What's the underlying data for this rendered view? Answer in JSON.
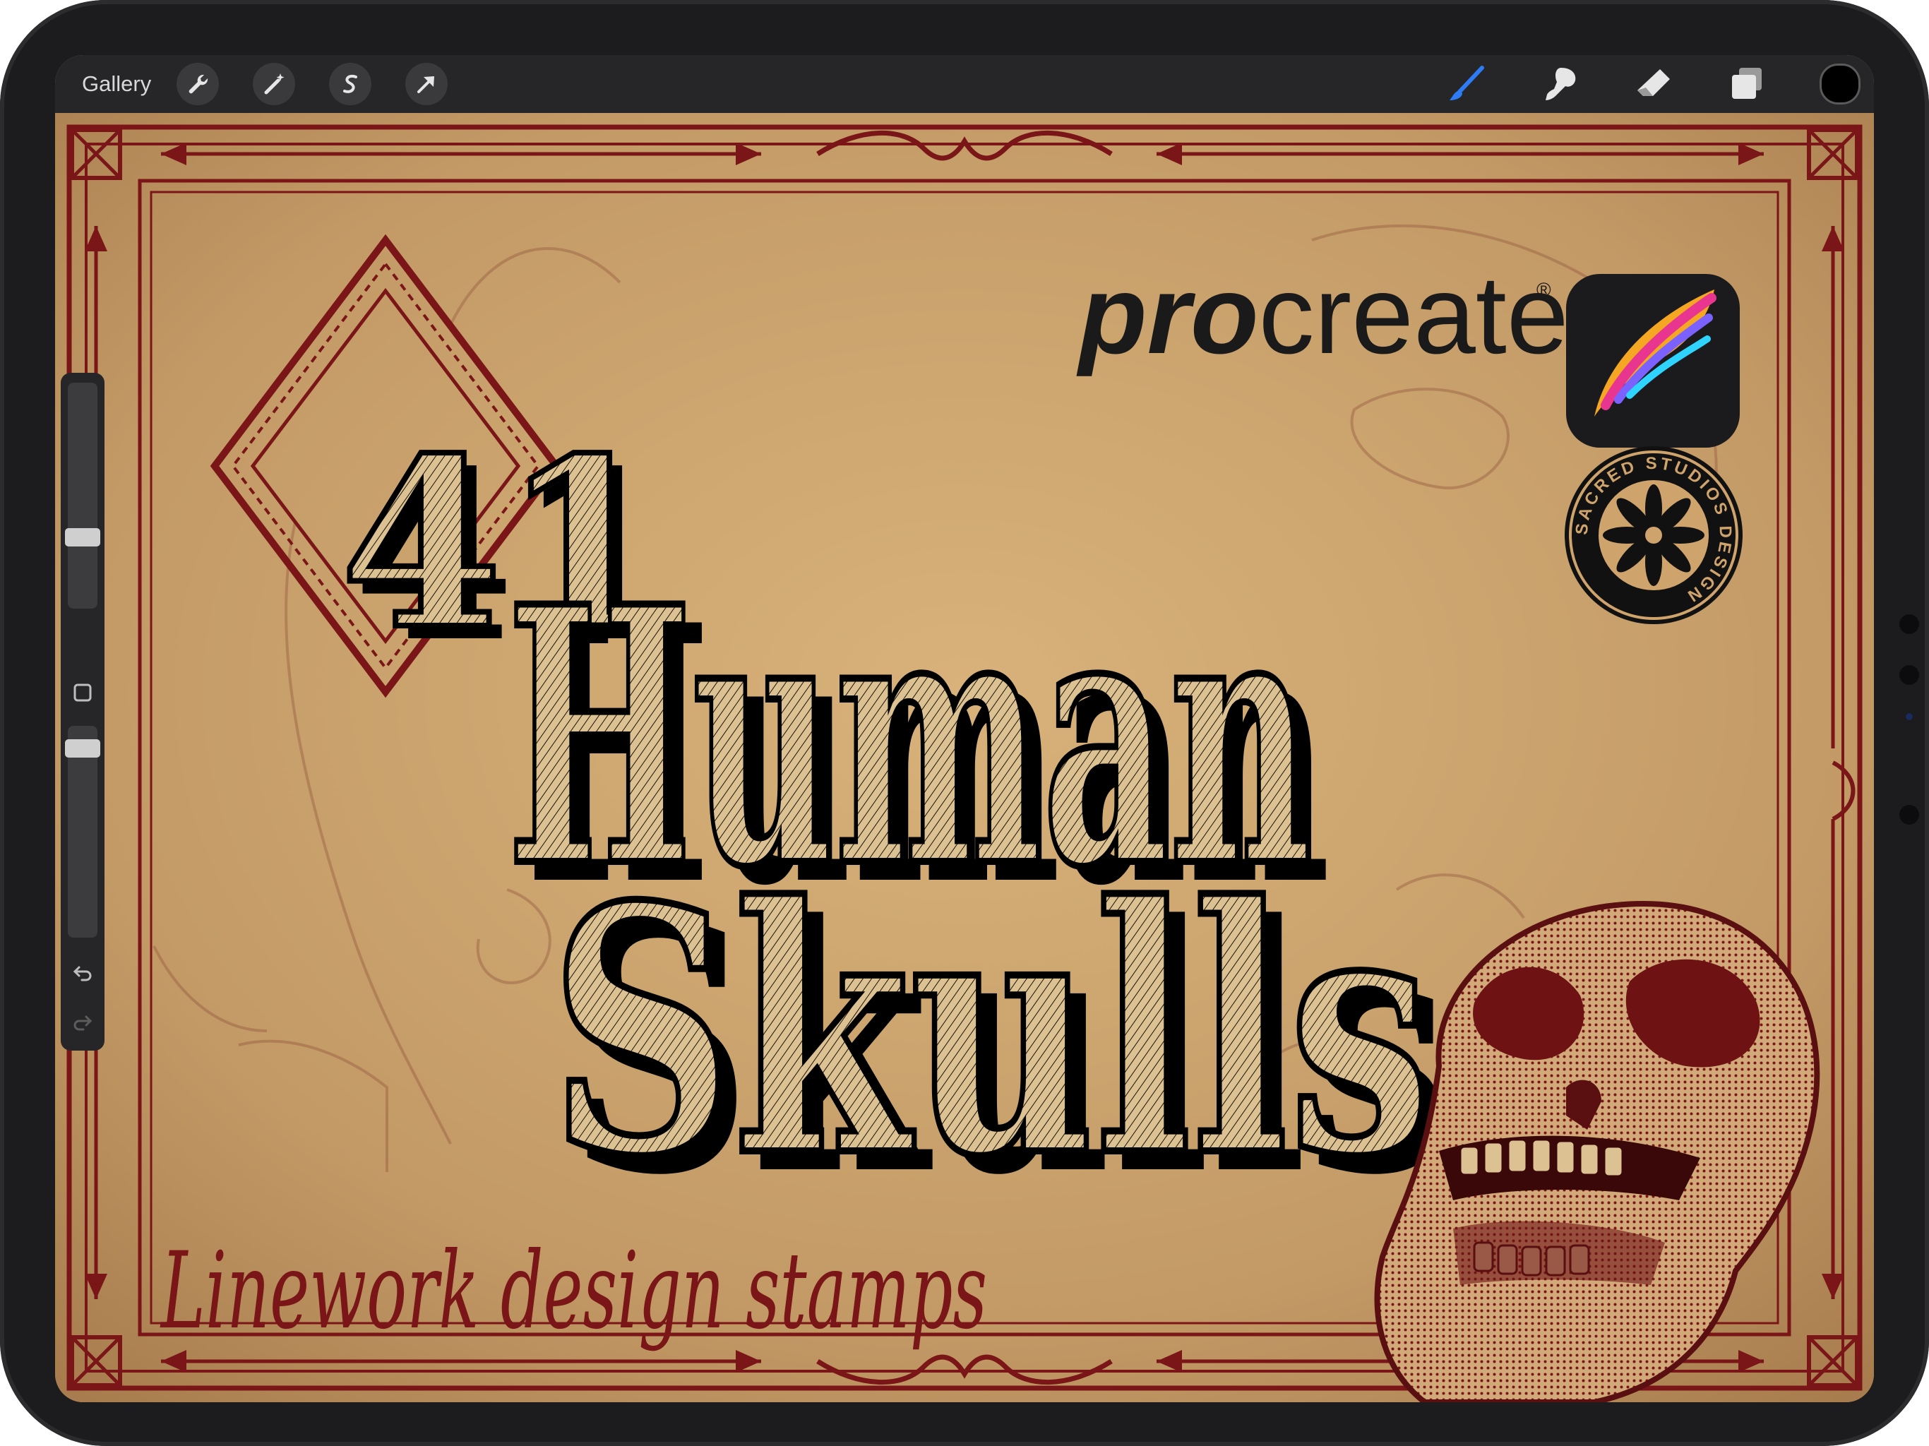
{
  "toolbar": {
    "gallery_label": "Gallery",
    "left_tools": [
      "wrench-icon",
      "magic-wand-icon",
      "selection-icon",
      "move-arrow-icon"
    ],
    "right_tools": [
      "brush-icon",
      "smudge-icon",
      "eraser-icon",
      "layers-icon"
    ],
    "active_tool": "brush-icon",
    "current_color": "#000000"
  },
  "sidebar": {
    "brush_size_level": 0.3,
    "opacity_level": 0.93,
    "icons": [
      "square-modify-icon",
      "undo-icon",
      "redo-icon"
    ]
  },
  "artwork": {
    "brand_word": "procreate",
    "registered_mark": "®",
    "number": "41",
    "title_line1": "Human",
    "title_line2": "Skulls",
    "subtitle": "Linework design stamps",
    "badge_text": "SACRED STUDIOS DESIGN",
    "colors": {
      "paper": "#c9a06b",
      "frame": "#7a1518",
      "title_fill": "#dcc292",
      "title_shadow": "#000000",
      "skull": "#8a1c1c"
    }
  }
}
